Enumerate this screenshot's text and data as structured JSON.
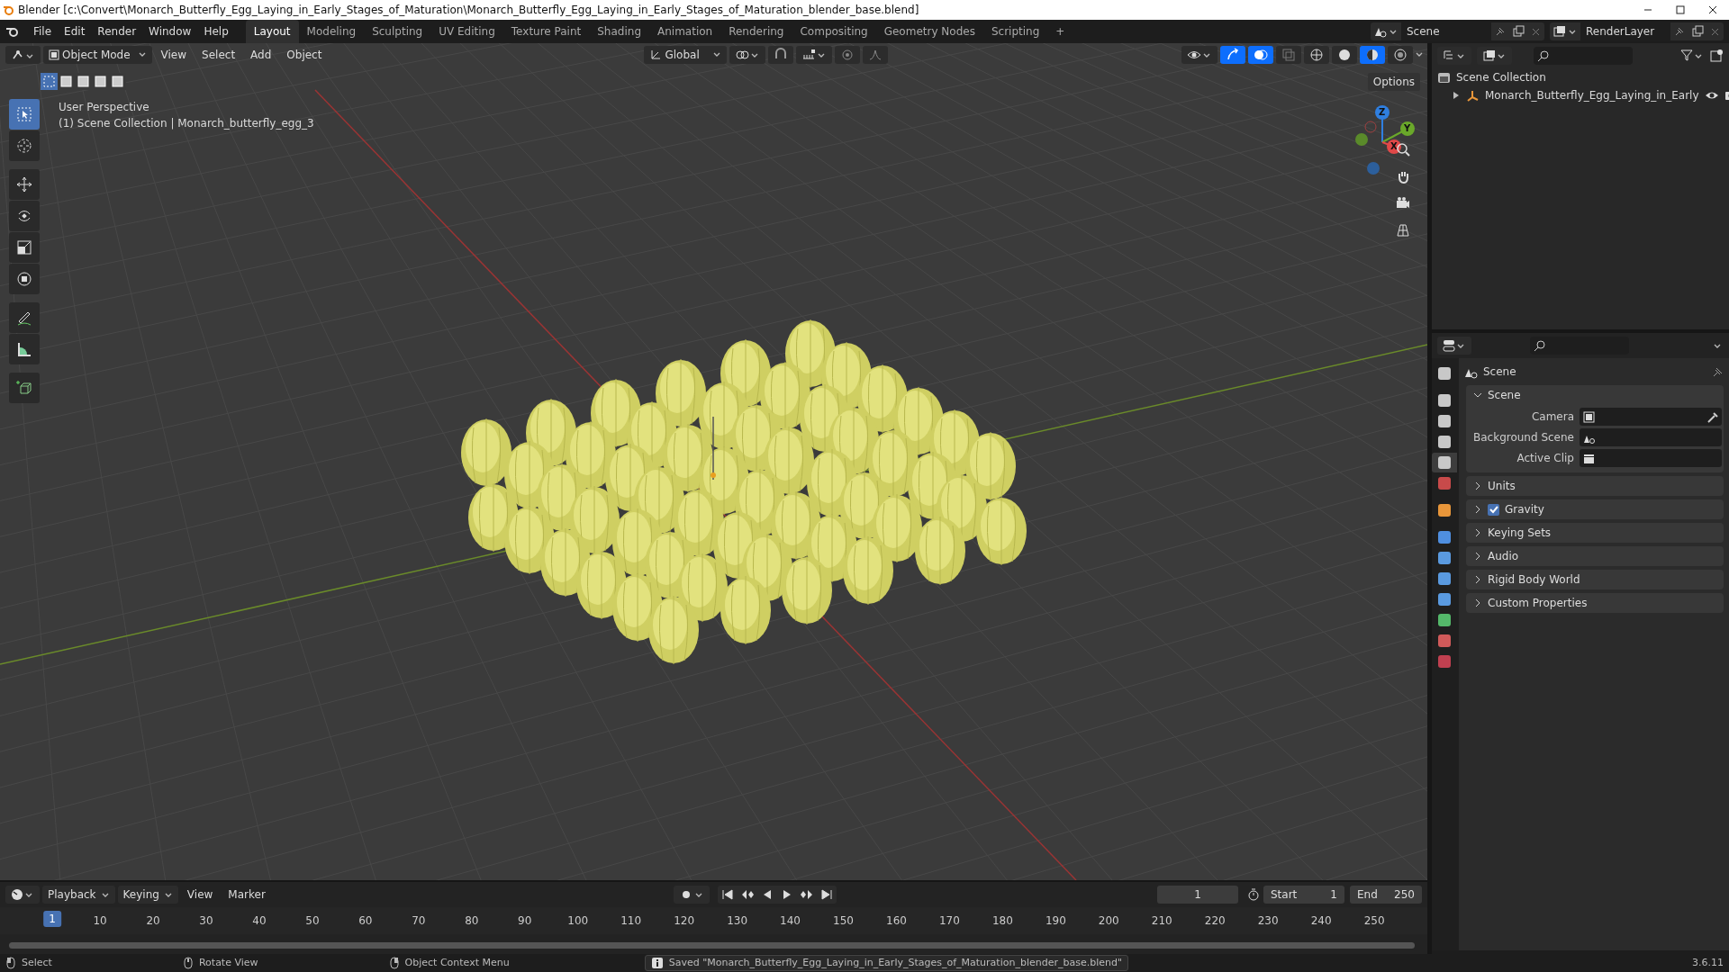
{
  "title_bar": {
    "title": "Blender [c:\\Convert\\Monarch_Butterfly_Egg_Laying_in_Early_Stages_of_Maturation\\Monarch_Butterfly_Egg_Laying_in_Early_Stages_of_Maturation_blender_base.blend]"
  },
  "menu": [
    "File",
    "Edit",
    "Render",
    "Window",
    "Help"
  ],
  "workspaces": [
    {
      "label": "Layout",
      "selected": true
    },
    {
      "label": "Modeling",
      "selected": false
    },
    {
      "label": "Sculpting",
      "selected": false
    },
    {
      "label": "UV Editing",
      "selected": false
    },
    {
      "label": "Texture Paint",
      "selected": false
    },
    {
      "label": "Shading",
      "selected": false
    },
    {
      "label": "Animation",
      "selected": false
    },
    {
      "label": "Rendering",
      "selected": false
    },
    {
      "label": "Compositing",
      "selected": false
    },
    {
      "label": "Geometry Nodes",
      "selected": false
    },
    {
      "label": "Scripting",
      "selected": false
    },
    {
      "label": "+",
      "selected": false
    }
  ],
  "scene_selector": {
    "scene": "Scene",
    "view_layer": "RenderLayer"
  },
  "viewport_header": {
    "mode": "Object Mode",
    "menus": [
      "View",
      "Select",
      "Add",
      "Object"
    ],
    "orientation": "Global",
    "shading_modes": [
      {
        "selected": false
      },
      {
        "selected": false
      },
      {
        "selected": true
      },
      {
        "selected": false
      }
    ],
    "select_modes": [
      {
        "selected": true
      },
      {
        "selected": false
      },
      {
        "selected": false
      },
      {
        "selected": false
      },
      {
        "selected": false
      }
    ]
  },
  "tools": [
    {
      "selected": true
    },
    {
      "selected": false
    },
    {
      "selected": false
    },
    {
      "selected": false
    },
    {
      "selected": false
    },
    {
      "selected": false
    },
    {
      "selected": false
    },
    {
      "selected": false
    },
    {
      "selected": false
    }
  ],
  "viewport": {
    "perspective": "User Perspective",
    "context": "(1) Scene Collection | Monarch_butterfly_egg_3",
    "options": "Options",
    "gizmo": [
      "Z",
      "Y",
      "X"
    ]
  },
  "outliner": {
    "root": "Scene Collection",
    "children": [
      {
        "label": "Monarch_Butterfly_Egg_Laying_in_Early",
        "expanded": false
      }
    ]
  },
  "properties": {
    "tabs": [
      {
        "color": "#c8c8c8",
        "selected": false
      },
      {
        "color": "#c8c8c8",
        "selected": false
      },
      {
        "color": "#c8c8c8",
        "selected": false
      },
      {
        "color": "#c8c8c8",
        "selected": false
      },
      {
        "color": "#c8c8c8",
        "selected": true
      },
      {
        "color": "#c84a4a",
        "selected": false
      },
      {
        "color": "#e8963a",
        "selected": false
      },
      {
        "color": "#4f8fe0",
        "selected": false
      },
      {
        "color": "#5a9ae0",
        "selected": false
      },
      {
        "color": "#5a9ae0",
        "selected": false
      },
      {
        "color": "#5a9ae0",
        "selected": false
      },
      {
        "color": "#54b86a",
        "selected": false
      },
      {
        "color": "#d05a5a",
        "selected": false
      },
      {
        "color": "#c04050",
        "selected": false
      }
    ],
    "title": "Scene",
    "panels": [
      {
        "kind": "plain",
        "label": "Scene",
        "expanded": true,
        "fields": [
          {
            "label": "Camera"
          },
          {
            "label": "Background Scene"
          },
          {
            "label": "Active Clip"
          }
        ]
      },
      {
        "kind": "plain",
        "label": "Units",
        "expanded": false
      },
      {
        "kind": "checkbox",
        "label": "Gravity",
        "expanded": false,
        "checked": true
      },
      {
        "kind": "plain",
        "label": "Keying Sets",
        "expanded": false
      },
      {
        "kind": "plain",
        "label": "Audio",
        "expanded": false
      },
      {
        "kind": "plain",
        "label": "Rigid Body World",
        "expanded": false
      },
      {
        "kind": "plain",
        "label": "Custom Properties",
        "expanded": false
      }
    ]
  },
  "timeline": {
    "menus": [
      "Playback",
      "Keying",
      "View",
      "Marker"
    ],
    "current_frame": "1",
    "start_label": "Start",
    "start": "1",
    "end_label": "End",
    "end": "250",
    "playhead": "1",
    "ticks": [
      "10",
      "20",
      "30",
      "40",
      "50",
      "60",
      "70",
      "80",
      "90",
      "100",
      "110",
      "120",
      "130",
      "140",
      "150",
      "160",
      "170",
      "180",
      "190",
      "200",
      "210",
      "220",
      "230",
      "240",
      "250"
    ]
  },
  "status_bar": {
    "hints": [
      "Select",
      "Rotate View",
      "Object Context Menu"
    ],
    "message": "Saved \"Monarch_Butterfly_Egg_Laying_in_Early_Stages_of_Maturation_blender_base.blend\"",
    "version": "3.6.11"
  }
}
